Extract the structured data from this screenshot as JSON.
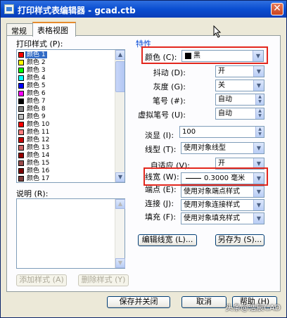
{
  "window": {
    "title": "打印样式表编辑器 - gcad.ctb",
    "close_symbol": "✕"
  },
  "tabs": [
    {
      "label": "常规"
    },
    {
      "label": "表格视图"
    }
  ],
  "left": {
    "print_styles_label": "打印样式 (P):",
    "styles": [
      {
        "label": "颜色 1",
        "color": "#ff0000",
        "selected": true
      },
      {
        "label": "颜色 2",
        "color": "#ffff00"
      },
      {
        "label": "颜色 3",
        "color": "#00ff00"
      },
      {
        "label": "颜色 4",
        "color": "#00ffff"
      },
      {
        "label": "颜色 5",
        "color": "#0000ff"
      },
      {
        "label": "颜色 6",
        "color": "#ff00ff"
      },
      {
        "label": "颜色 7",
        "color": "#000000"
      },
      {
        "label": "颜色 8",
        "color": "#808080"
      },
      {
        "label": "颜色 9",
        "color": "#c0c0c0"
      },
      {
        "label": "颜色 10",
        "color": "#ff0000"
      },
      {
        "label": "颜色 11",
        "color": "#ff7f7f"
      },
      {
        "label": "颜色 12",
        "color": "#cc0000"
      },
      {
        "label": "颜色 13",
        "color": "#cc6666"
      },
      {
        "label": "颜色 14",
        "color": "#990000"
      },
      {
        "label": "颜色 15",
        "color": "#994c4c"
      },
      {
        "label": "颜色 16",
        "color": "#7f0000"
      },
      {
        "label": "颜色 17",
        "color": "#7f3f3f"
      }
    ],
    "description_label": "说明 (R):",
    "add_style_label": "添加样式 (A)",
    "delete_style_label": "删除样式 (Y)"
  },
  "properties": {
    "group_title": "特性",
    "color": {
      "label": "颜色 (C):",
      "value": "黑",
      "swatch": "#000000"
    },
    "dither": {
      "label": "抖动 (D):",
      "value": "开"
    },
    "grayscale": {
      "label": "灰度 (G):",
      "value": "关"
    },
    "pen": {
      "label": "笔号 (#):",
      "value": "自动"
    },
    "virtual_pen": {
      "label": "虚拟笔号 (U):",
      "value": "自动"
    },
    "screening": {
      "label": "淡显 (I):",
      "value": "100"
    },
    "linetype": {
      "label": "线型 (T):",
      "value": "使用对象线型"
    },
    "adaptive": {
      "label": "自适应 (V):",
      "value": "开"
    },
    "lineweight": {
      "label": "线宽 (W):",
      "value": "0.3000 毫米"
    },
    "line_end": {
      "label": "端点 (E):",
      "value": "使用对象端点样式"
    },
    "line_join": {
      "label": "连接 (J):",
      "value": "使用对象连接样式"
    },
    "fill": {
      "label": "填充 (F):",
      "value": "使用对象填充样式"
    },
    "edit_lineweights_label": "编辑线宽 (L)...",
    "save_as_label": "另存为 (S)..."
  },
  "footer": {
    "save_close_label": "保存并关闭",
    "cancel_label": "取消",
    "help_label": "帮助 (H)"
  },
  "watermark": "头条@浩辰CAD",
  "colors": {
    "highlight": "#e3271d",
    "title_bar": "#0a4ed1",
    "selection": "#316ac5"
  }
}
